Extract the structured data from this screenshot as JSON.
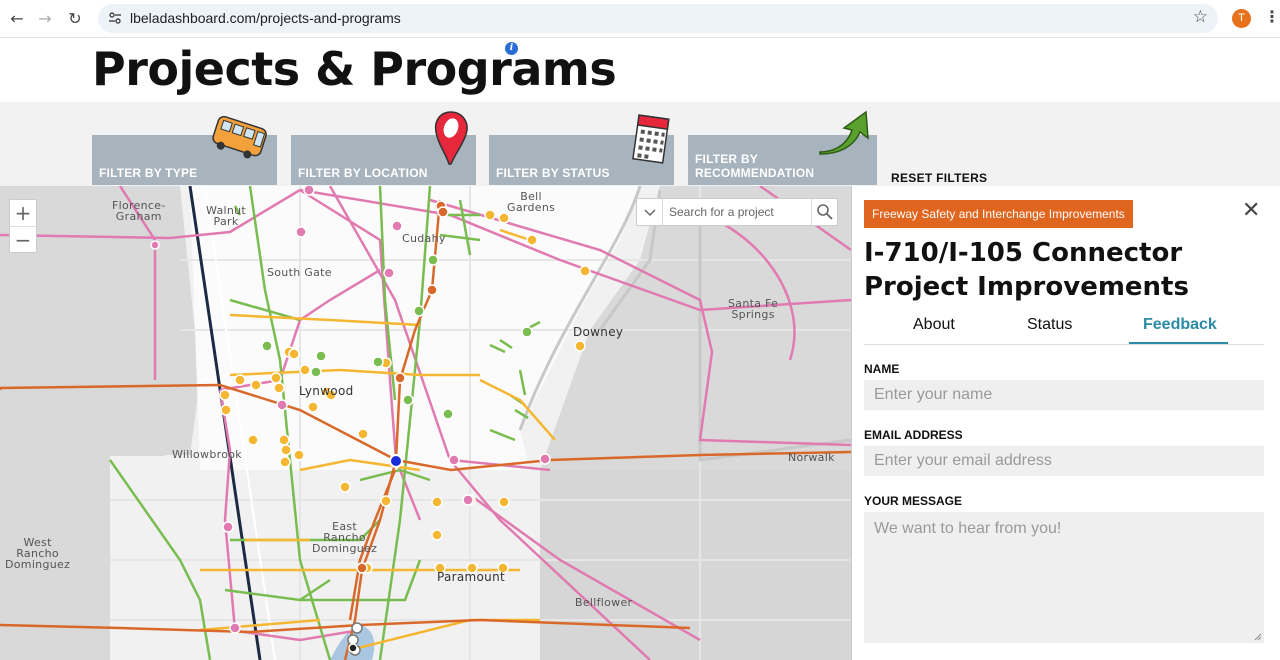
{
  "browser": {
    "url": "lbeladashboard.com/projects-and-programs",
    "avatar_letter": "T"
  },
  "page": {
    "title": "Projects & Programs",
    "info_icon": "i"
  },
  "filters": {
    "type": "FILTER BY TYPE",
    "location": "FILTER BY LOCATION",
    "status": "FILTER BY STATUS",
    "recommendation": "FILTER BY RECOMMENDATION",
    "reset": "RESET FILTERS"
  },
  "map": {
    "search_placeholder": "Search for a project",
    "zoom_in": "+",
    "zoom_out": "−",
    "places": {
      "florence_graham": "Florence-\nGraham",
      "walnut_park": "Walnut\nPark",
      "bell_gardens": "Bell\nGardens",
      "cudahy": "Cudahy",
      "south_gate": "South Gate",
      "downey": "Downey",
      "santa_fe_springs": "Santa Fe\nSprings",
      "lynwood": "Lynwood",
      "willowbrook": "Willowbrook",
      "norwalk": "Norwalk",
      "east_rancho_dominguez": "East\nRancho\nDominguez",
      "west_rancho_dominguez": "West\nRancho\nDominguez",
      "paramount": "Paramount",
      "bellflower": "Bellflower"
    },
    "colors": {
      "transit": "#e07ab0",
      "active": "#79bc4f",
      "planned": "#f5b731",
      "freeway": "#d9692b",
      "rail": "#1d2a44"
    }
  },
  "panel": {
    "category_tag": "Freeway Safety and Interchange Improvements",
    "title": "I-710/I-105 Connector Project Improvements",
    "tabs": [
      "About",
      "Status",
      "Feedback"
    ],
    "active_tab": "Feedback",
    "form": {
      "name_label": "NAME",
      "name_placeholder": "Enter your name",
      "email_label": "EMAIL ADDRESS",
      "email_placeholder": "Enter your email address",
      "message_label": "YOUR MESSAGE",
      "message_placeholder": "We want to hear from you!"
    }
  }
}
